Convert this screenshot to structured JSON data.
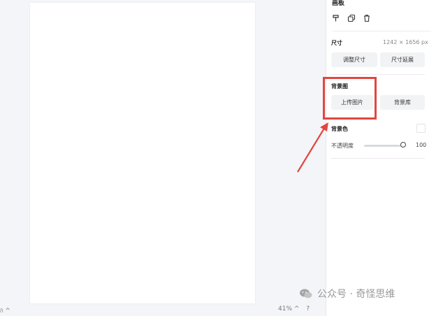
{
  "panel": {
    "title": "画板",
    "size_label": "尺寸",
    "size_value": "1242 × 1656 px",
    "resize_button": "调整尺寸",
    "extend_button": "尺寸延展",
    "bg_image_label": "背景图",
    "upload_button": "上传图片",
    "library_button": "背景库",
    "bg_color_label": "背景色",
    "opacity_label": "不透明度",
    "opacity_value": "100"
  },
  "bottom": {
    "left_text": "ﾊ ^",
    "zoom": "41% ^",
    "help": "?"
  },
  "watermark": {
    "text": "公众号 · 奇怪思维"
  },
  "colors": {
    "highlight": "#e2463f",
    "panel_bg": "#ffffff",
    "canvas_bg": "#f4f5f8"
  }
}
